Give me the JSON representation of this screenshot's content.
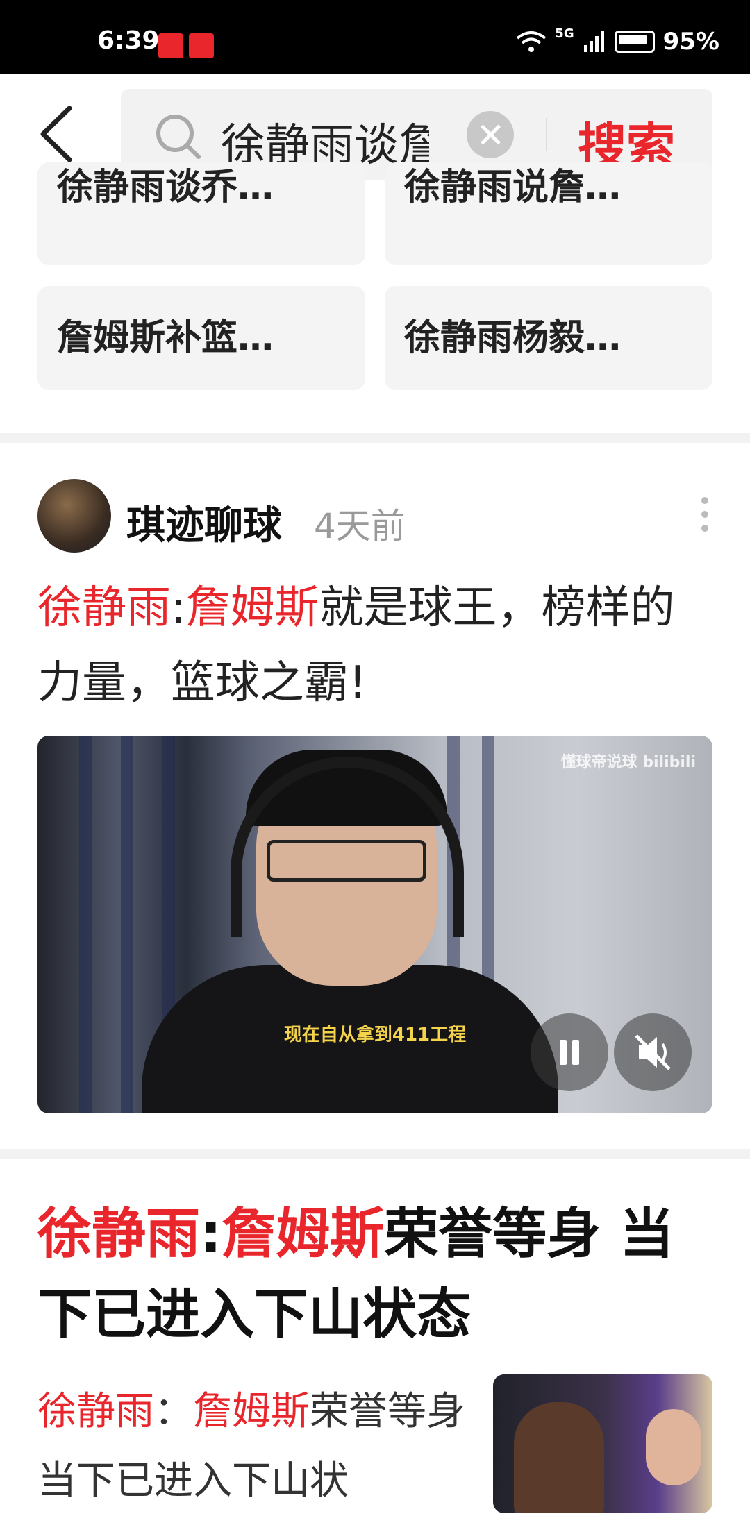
{
  "status_bar": {
    "time": "6:39",
    "network": "5G",
    "battery": "95%"
  },
  "search": {
    "query": "徐静雨谈詹",
    "button_label": "搜索"
  },
  "suggestions": [
    "徐静雨谈乔…",
    "徐静雨说詹…",
    "詹姆斯补篮…",
    "徐静雨杨毅…"
  ],
  "post1": {
    "author": "琪迹聊球",
    "time": "4天前",
    "title_red1": "徐静雨",
    "title_sep": ":",
    "title_red2": "詹姆斯",
    "title_rest": "就是球王，榜样的力量，篮球之霸!",
    "video": {
      "watermark": "懂球帝说球 bilibili",
      "subtitle": "现在自从拿到411工程"
    }
  },
  "post2": {
    "title_red1": "徐静雨",
    "title_sep": ":",
    "title_red2": "詹姆斯",
    "title_rest": "荣誉等身 当下已进入下山状态",
    "snippet_red1": "徐静雨",
    "snippet_sep": "：",
    "snippet_red2": "詹姆斯",
    "snippet_rest": "荣誉等身 当下已进入下山状"
  }
}
